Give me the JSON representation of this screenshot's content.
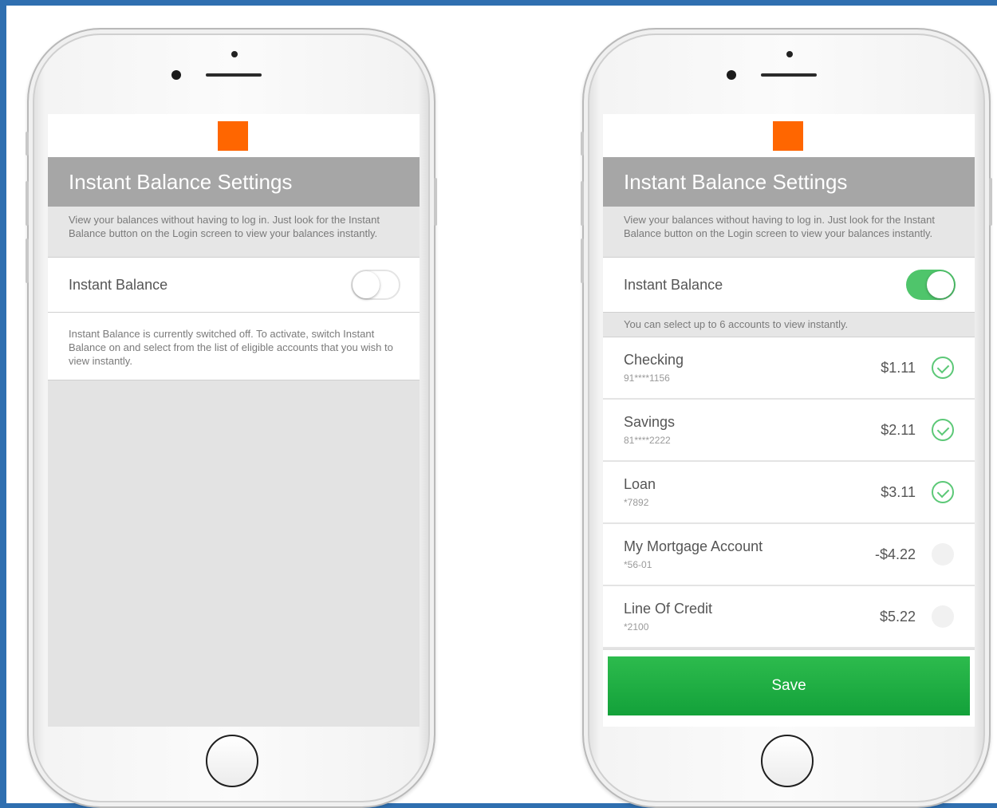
{
  "colors": {
    "accent_orange": "#ff6600",
    "toggle_on": "#4fc56b",
    "save_green": "#1aaa40",
    "header_gray": "#a6a6a6",
    "frame_blue": "#2f6fb0"
  },
  "left_screen": {
    "title": "Instant Balance Settings",
    "description": "View your balances without having to log in. Just look for the Instant Balance button on the Login screen to view your balances instantly.",
    "toggle_label": "Instant Balance",
    "toggle_state": "off",
    "off_note": "Instant Balance is currently switched off. To activate, switch Instant Balance on and select from the list of eligible accounts that you wish to view instantly."
  },
  "right_screen": {
    "title": "Instant Balance Settings",
    "description": "View your balances without having to log in. Just look for the Instant Balance button on the Login screen to view your balances instantly.",
    "toggle_label": "Instant Balance",
    "toggle_state": "on",
    "select_note": "You can select up to 6 accounts to view instantly.",
    "accounts": [
      {
        "name": "Checking",
        "number": "91****1156",
        "balance": "$1.11",
        "selected": true,
        "check_icon": "check-circle-icon"
      },
      {
        "name": "Savings",
        "number": "81****2222",
        "balance": "$2.11",
        "selected": true,
        "check_icon": "check-circle-icon"
      },
      {
        "name": "Loan",
        "number": "*7892",
        "balance": "$3.11",
        "selected": true,
        "check_icon": "check-circle-icon"
      },
      {
        "name": "My Mortgage Account",
        "number": "*56-01",
        "balance": "-$4.22",
        "selected": false,
        "check_icon": "empty-circle-icon"
      },
      {
        "name": "Line Of Credit",
        "number": "*2100",
        "balance": "$5.22",
        "selected": false,
        "check_icon": "empty-circle-icon"
      }
    ],
    "save_label": "Save"
  }
}
